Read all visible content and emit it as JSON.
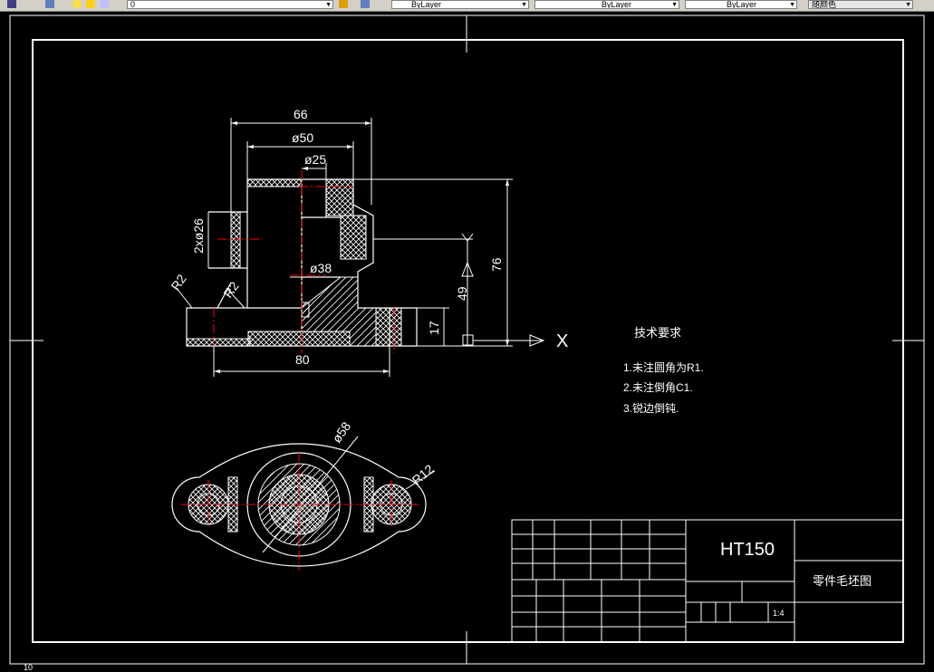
{
  "toolbar": {
    "layer_value": "0",
    "color_control": "ByLayer",
    "linetype_control": "ByLayer",
    "lineweight_control": "ByLayer",
    "plotstyle_control": "随颜色"
  },
  "drawing": {
    "dims": {
      "d66": "66",
      "d50": "ø50",
      "d25": "ø25",
      "d2x26": "2xø26",
      "d38": "ø38",
      "r2a": "R2",
      "r2b": "R2",
      "d80": "80",
      "d49": "49",
      "d17": "17",
      "d76": "76",
      "d58": "ø58",
      "r12": "R12"
    },
    "axis_x": "X",
    "axis_y": "Y",
    "notes": {
      "title": "技术要求",
      "items": [
        "1.未注圆角为R1.",
        "2.未注倒角C1.",
        "3.锐边倒钝."
      ]
    },
    "title_block": {
      "material": "HT150",
      "part_name": "零件毛坯图",
      "scale": "1:4"
    }
  },
  "status": {
    "ucs_label": "10"
  },
  "colors": {
    "background": "#000000",
    "line": "#ffffff",
    "centerline": "#ff0000",
    "hatch_fill": "#ffffff"
  }
}
